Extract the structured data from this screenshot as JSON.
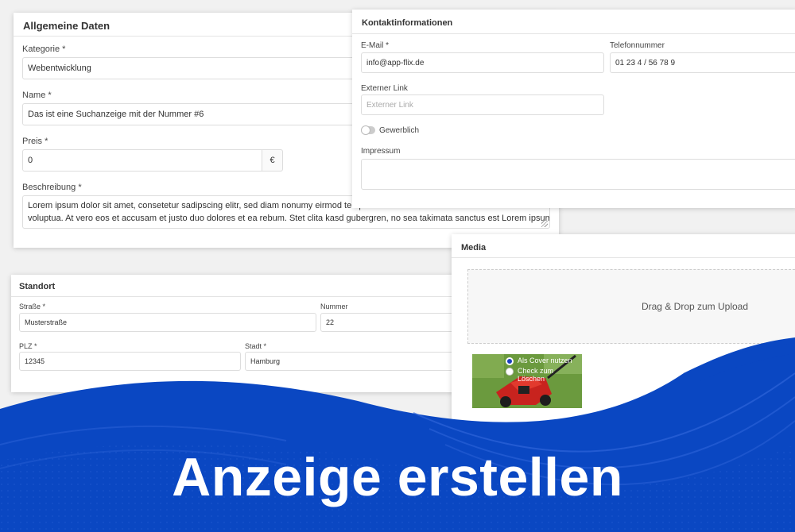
{
  "general": {
    "title": "Allgemeine Daten",
    "category_label": "Kategorie *",
    "category_value": "Webentwicklung",
    "name_label": "Name *",
    "name_value": "Das ist eine Suchanzeige mit der Nummer #6",
    "price_label": "Preis *",
    "price_value": "0",
    "currency": "€",
    "description_label": "Beschreibung *",
    "description_line1": "Lorem ipsum dolor sit amet, consetetur sadipscing elitr, sed diam nonumy eirmod tempor invidu",
    "description_line2": "voluptua. At vero eos et accusam et justo duo dolores et ea rebum. Stet clita kasd gubergren, no sea takimata sanctus est Lorem ipsum dolor sit amet."
  },
  "contact": {
    "title": "Kontaktinformationen",
    "email_label": "E-Mail *",
    "email_value": "info@app-flix.de",
    "phone_label": "Telefonnummer",
    "phone_value": "01 23 4 / 56 78 9",
    "link_label": "Externer Link",
    "link_placeholder": "Externer Link",
    "commercial_label": "Gewerblich",
    "commercial_checked": false,
    "imprint_label": "Impressum"
  },
  "location": {
    "title": "Standort",
    "street_label": "Straße *",
    "street_value": "Musterstraße",
    "number_label": "Nummer",
    "number_value": "22",
    "zip_label": "PLZ *",
    "zip_value": "12345",
    "city_label": "Stadt *",
    "city_value": "Hamburg"
  },
  "media": {
    "title": "Media",
    "dropzone_text": "Drag & Drop zum Upload",
    "cover_option": "Als Cover nutzen",
    "delete_option": "Check zum Löschen"
  },
  "banner": {
    "headline": "Anzeige erstellen",
    "color": "#0a47c2"
  }
}
